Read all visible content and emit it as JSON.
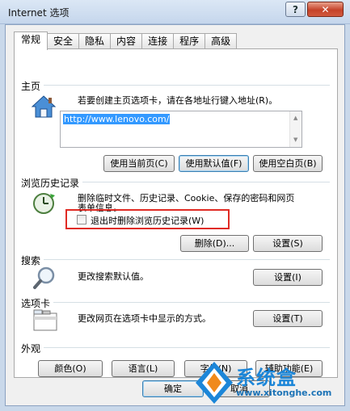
{
  "window": {
    "title": "Internet 选项",
    "help_label": "?",
    "close_label": "✕"
  },
  "tabs": [
    {
      "label": "常规"
    },
    {
      "label": "安全"
    },
    {
      "label": "隐私"
    },
    {
      "label": "内容"
    },
    {
      "label": "连接"
    },
    {
      "label": "程序"
    },
    {
      "label": "高级"
    }
  ],
  "homepage": {
    "group_label": "主页",
    "description": "若要创建主页选项卡，请在各地址行键入地址(R)。",
    "url_value": "http://www.lenovo.com/",
    "btn_current": "使用当前页(C)",
    "btn_default": "使用默认值(F)",
    "btn_blank": "使用空白页(B)"
  },
  "history": {
    "group_label": "浏览历史记录",
    "description_line1": "删除临时文件、历史记录、Cookie、保存的密码和网页",
    "description_line2": "表单信息。",
    "checkbox_label": "退出时删除浏览历史记录(W)",
    "checkbox_checked": false,
    "btn_delete": "删除(D)...",
    "btn_settings": "设置(S)"
  },
  "search": {
    "group_label": "搜索",
    "description": "更改搜索默认值。",
    "btn_settings": "设置(I)"
  },
  "tabs_section": {
    "group_label": "选项卡",
    "description": "更改网页在选项卡中显示的方式。",
    "btn_settings": "设置(T)"
  },
  "appearance": {
    "group_label": "外观",
    "btn_colors": "颜色(O)",
    "btn_languages": "语言(L)",
    "btn_fonts": "字体(N)",
    "btn_accessibility": "辅助功能(E)"
  },
  "footer": {
    "btn_ok": "确定",
    "btn_cancel": "取消"
  },
  "watermark": {
    "brand": "系统盒",
    "url": "www.xitonghe.com"
  }
}
